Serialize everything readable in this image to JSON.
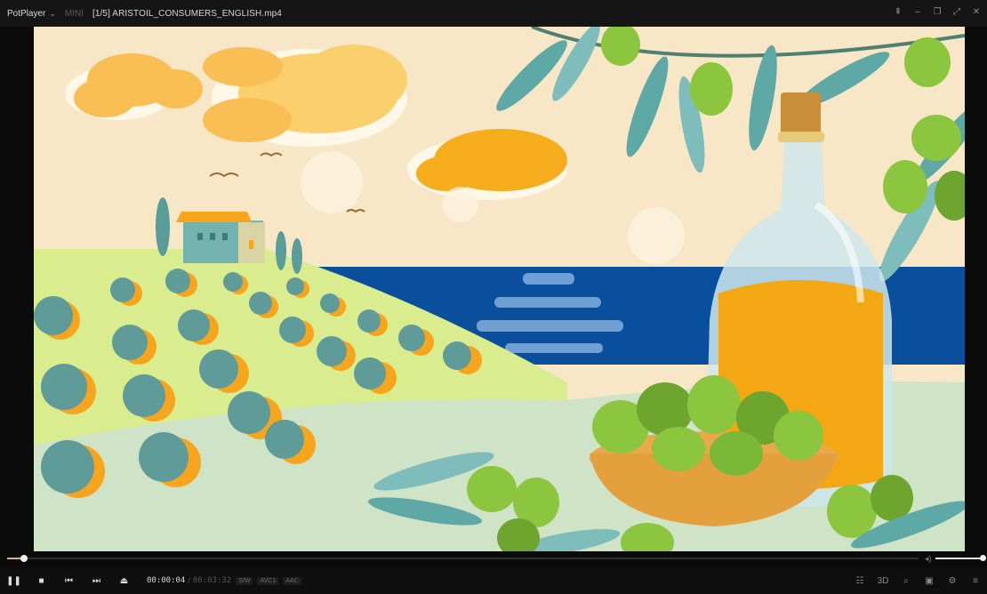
{
  "titlebar": {
    "app_name": "PotPlayer",
    "mini_label": "MINI",
    "file_title": "[1/5] ARISTOIL_CONSUMERS_ENGLISH.mp4"
  },
  "window_controls": [
    "pin-icon",
    "minimize-icon",
    "restore-icon",
    "fullscreen-icon",
    "close-icon"
  ],
  "playback": {
    "current_time": "00:00:04",
    "separator": "/",
    "total_time": "00:03:32",
    "tags": [
      "S/W",
      "AVC1",
      "AAC"
    ],
    "progress": 0.019,
    "volume": 1.0
  },
  "controls": {
    "left": [
      "pause-icon",
      "stop-icon",
      "previous-icon",
      "next-icon",
      "eject-icon"
    ],
    "right": [
      "playlist-icon",
      "3d-icon",
      "zoom-icon",
      "screen-icon",
      "settings-icon",
      "menu-icon"
    ]
  },
  "colors": {
    "accent": "#d8b86a",
    "sky": "#f7e7c7",
    "sea": "#0a4f9c",
    "oil": "#f3a713",
    "olive": "#8cc63f",
    "leaf": "#5ea8a6"
  }
}
